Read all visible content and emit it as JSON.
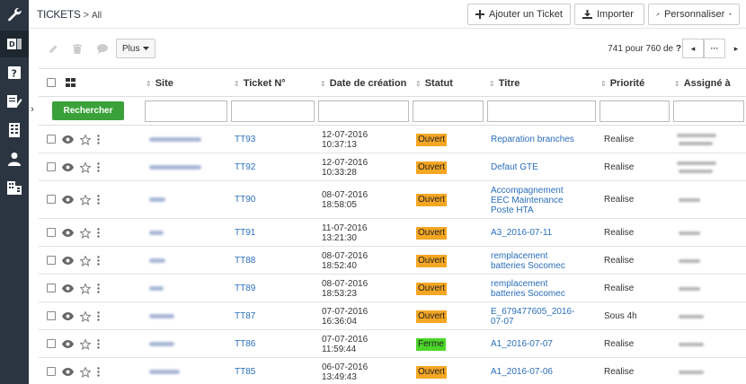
{
  "header": {
    "title": "TICKETS",
    "separator": ">",
    "filter": "All",
    "add_ticket_label": "Ajouter un Ticket",
    "import_label": "Importer",
    "customize_label": "Personnaliser"
  },
  "toolbar": {
    "more_label": "Plus",
    "pager_text": "741 pour 760",
    "pager_of": "de",
    "pager_total": "?",
    "prev_label": "◂",
    "dots_label": "···",
    "next_label": "▸"
  },
  "table": {
    "columns": [
      "Site",
      "Ticket N°",
      "Date de création",
      "Statut",
      "Titre",
      "Priorité",
      "Assigné à"
    ],
    "search_label": "Rechercher",
    "rows": [
      {
        "ticket": "TT93",
        "date": "12-07-2016",
        "time": "10:37:13",
        "status": "Ouvert",
        "title": [
          "Reparation branches"
        ],
        "priority": "Realise"
      },
      {
        "ticket": "TT92",
        "date": "12-07-2016",
        "time": "10:33:28",
        "status": "Ouvert",
        "title": [
          "Defaut GTE"
        ],
        "priority": "Realise"
      },
      {
        "ticket": "TT90",
        "date": "08-07-2016",
        "time": "18:58:05",
        "status": "Ouvert",
        "title": [
          "Accompagnement",
          "EEC Maintenance",
          "Poste HTA"
        ],
        "priority": "Realise"
      },
      {
        "ticket": "TT91",
        "date": "11-07-2016",
        "time": "13:21:30",
        "status": "Ouvert",
        "title": [
          "A3_2016-07-11"
        ],
        "priority": "Realise"
      },
      {
        "ticket": "TT88",
        "date": "08-07-2016",
        "time": "18:52:40",
        "status": "Ouvert",
        "title": [
          "remplacement",
          "batteries Socomec"
        ],
        "priority": "Realise"
      },
      {
        "ticket": "TT89",
        "date": "08-07-2016",
        "time": "18:53:23",
        "status": "Ouvert",
        "title": [
          "remplacement",
          "batteries Socomec"
        ],
        "priority": "Realise"
      },
      {
        "ticket": "TT87",
        "date": "07-07-2016",
        "time": "16:36:04",
        "status": "Ouvert",
        "title": [
          "E_679477605_2016-",
          "07-07"
        ],
        "priority": "Sous 4h"
      },
      {
        "ticket": "TT86",
        "date": "07-07-2016",
        "time": "11:59:44",
        "status": "Ferme",
        "title": [
          "A1_2016-07-07"
        ],
        "priority": "Realise"
      },
      {
        "ticket": "TT85",
        "date": "06-07-2016",
        "time": "13:49:43",
        "status": "Ouvert",
        "title": [
          "A1_2016-07-06"
        ],
        "priority": "Realise"
      }
    ]
  },
  "colors": {
    "sidebar": "#2b3541",
    "status_open": "#f5a623",
    "status_closed": "#4cd62a",
    "link": "#2a6ebb",
    "search_button": "#3aa13a"
  }
}
